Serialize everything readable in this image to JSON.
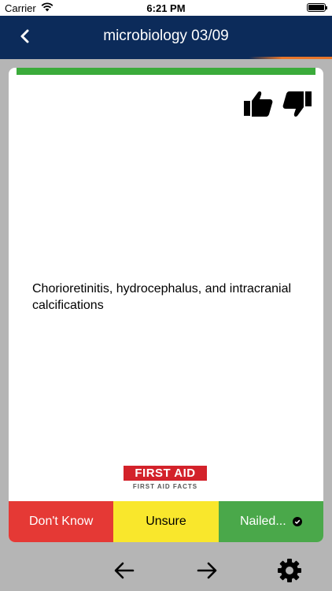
{
  "status_bar": {
    "carrier": "Carrier",
    "time": "6:21 PM",
    "wifi_icon": "wifi-icon",
    "battery_icon": "battery-icon"
  },
  "nav": {
    "title": "microbiology 03/09",
    "back_icon": "chevron-left-icon",
    "bar_color": "#0c2b5a",
    "accent_color": "#e8762b"
  },
  "card": {
    "progress_color": "#3bab3b",
    "question": "Chorioretinitis, hydrocephalus, and intracranial calcifications",
    "like_icon": "thumbs-up-icon",
    "dislike_icon": "thumbs-down-icon",
    "logo": {
      "brand": "FIRST AID",
      "subtitle": "FIRST AID FACTS"
    }
  },
  "answers": {
    "dont_know": "Don't Know",
    "unsure": "Unsure",
    "nailed": "Nailed...",
    "colors": {
      "dont_know": "#e53935",
      "unsure": "#f9e72c",
      "nailed": "#4aa84a"
    }
  },
  "toolbar": {
    "icons": [
      "arrow-left-icon",
      "arrow-right-icon",
      "gear-icon"
    ]
  }
}
